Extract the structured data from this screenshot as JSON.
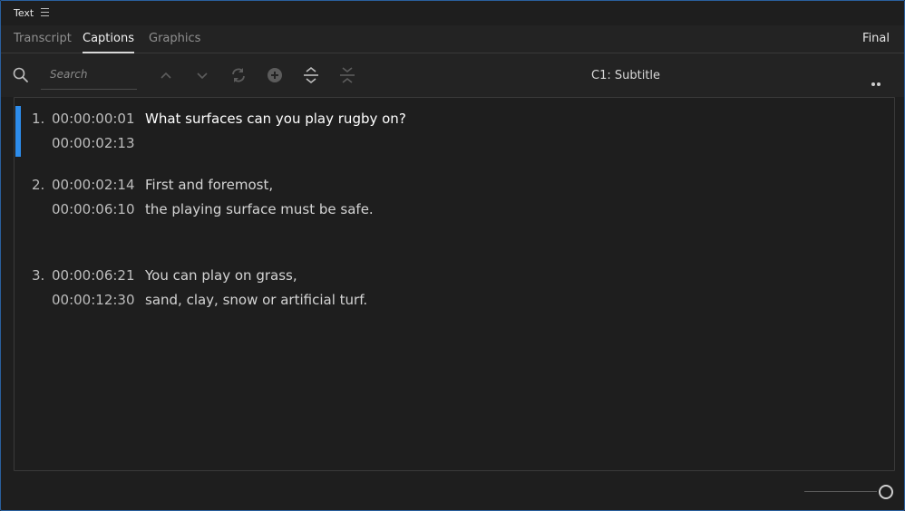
{
  "panel": {
    "title": "Text"
  },
  "tabs": [
    {
      "label": "Transcript",
      "active": false
    },
    {
      "label": "Captions",
      "active": true
    },
    {
      "label": "Graphics",
      "active": false
    }
  ],
  "status_label": "Final",
  "search": {
    "placeholder": "Search",
    "value": ""
  },
  "toolbar": {
    "icons": [
      "search-icon",
      "chevron-up-icon",
      "chevron-down-icon",
      "refresh-icon",
      "add-circle-icon",
      "split-caption-icon",
      "merge-caption-icon",
      "more-icon"
    ],
    "track_label": "C1: Subtitle"
  },
  "captions": [
    {
      "number": "1.",
      "start": "00:00:00:01",
      "end": "00:00:02:13",
      "lines": [
        "What surfaces can you play rugby on?"
      ],
      "selected": true
    },
    {
      "number": "2.",
      "start": "00:00:02:14",
      "end": "00:00:06:10",
      "lines": [
        "First and foremost,",
        "the playing surface must be safe."
      ],
      "selected": false
    },
    {
      "number": "3.",
      "start": "00:00:06:21",
      "end": "00:00:12:30",
      "lines": [
        "You can play on grass,",
        "sand, clay, snow or artificial turf."
      ],
      "selected": false
    }
  ],
  "colors": {
    "accent": "#2d8ceb",
    "background": "#1e1e1e",
    "border": "#2a5f9e"
  }
}
